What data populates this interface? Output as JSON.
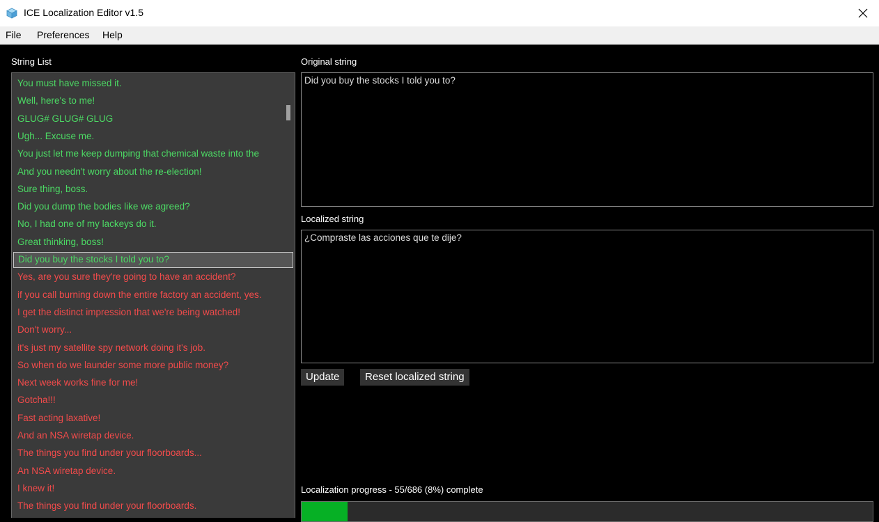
{
  "window": {
    "title": "ICE Localization Editor v1.5",
    "close_glyph": "✕"
  },
  "menu": [
    "File",
    "Preferences",
    "Help"
  ],
  "string_list": {
    "label": "String List",
    "selected_index": 10,
    "items": [
      {
        "text": "You must have missed it.",
        "status": "done"
      },
      {
        "text": "Well, here's to me!",
        "status": "done"
      },
      {
        "text": "GLUG#  GLUG#    GLUG",
        "status": "done"
      },
      {
        "text": "Ugh... Excuse me.",
        "status": "done"
      },
      {
        "text": "You just let me keep dumping that chemical waste into the",
        "status": "done"
      },
      {
        "text": "And you needn't worry about the re-election!",
        "status": "done"
      },
      {
        "text": "Sure thing, boss.",
        "status": "done"
      },
      {
        "text": "Did you dump the bodies like we agreed?",
        "status": "done"
      },
      {
        "text": "No, I had one of my lackeys do it.",
        "status": "done"
      },
      {
        "text": "Great thinking, boss!",
        "status": "done"
      },
      {
        "text": "Did you buy the stocks I told you to?",
        "status": "done"
      },
      {
        "text": "Yes, are you sure they're going to have an accident?",
        "status": "todo"
      },
      {
        "text": "if you call burning down the entire factory an accident, yes.",
        "status": "todo"
      },
      {
        "text": "I get the distinct impression that we're being watched!",
        "status": "todo"
      },
      {
        "text": "Don't worry...",
        "status": "todo"
      },
      {
        "text": "it's just my satellite spy network doing it's job.",
        "status": "todo"
      },
      {
        "text": "So when do we launder some more public money?",
        "status": "todo"
      },
      {
        "text": "Next week works fine for me!",
        "status": "todo"
      },
      {
        "text": "Gotcha!!!",
        "status": "todo"
      },
      {
        "text": "Fast acting laxative!",
        "status": "todo"
      },
      {
        "text": "And an NSA wiretap device.",
        "status": "todo"
      },
      {
        "text": "The things you find under your floorboards...",
        "status": "todo"
      },
      {
        "text": "An NSA wiretap device.",
        "status": "todo"
      },
      {
        "text": "I knew it!",
        "status": "todo"
      },
      {
        "text": "The things you find under your floorboards.",
        "status": "todo"
      }
    ]
  },
  "original": {
    "label": "Original string",
    "value": "Did you buy the stocks I told you to?"
  },
  "localized": {
    "label": "Localized string",
    "value": "¿Compraste las acciones que te dije?"
  },
  "buttons": {
    "update": "Update",
    "reset": "Reset localized string"
  },
  "progress": {
    "label": "Localization progress - 55/686 (8%) complete",
    "done": 55,
    "total": 686,
    "fraction": 0.08
  },
  "colors": {
    "done": "#4cd964",
    "todo": "#f24b4b",
    "progress_fill": "#06b025"
  },
  "icons": {
    "app": "ice-cube-icon",
    "close": "close-icon"
  }
}
